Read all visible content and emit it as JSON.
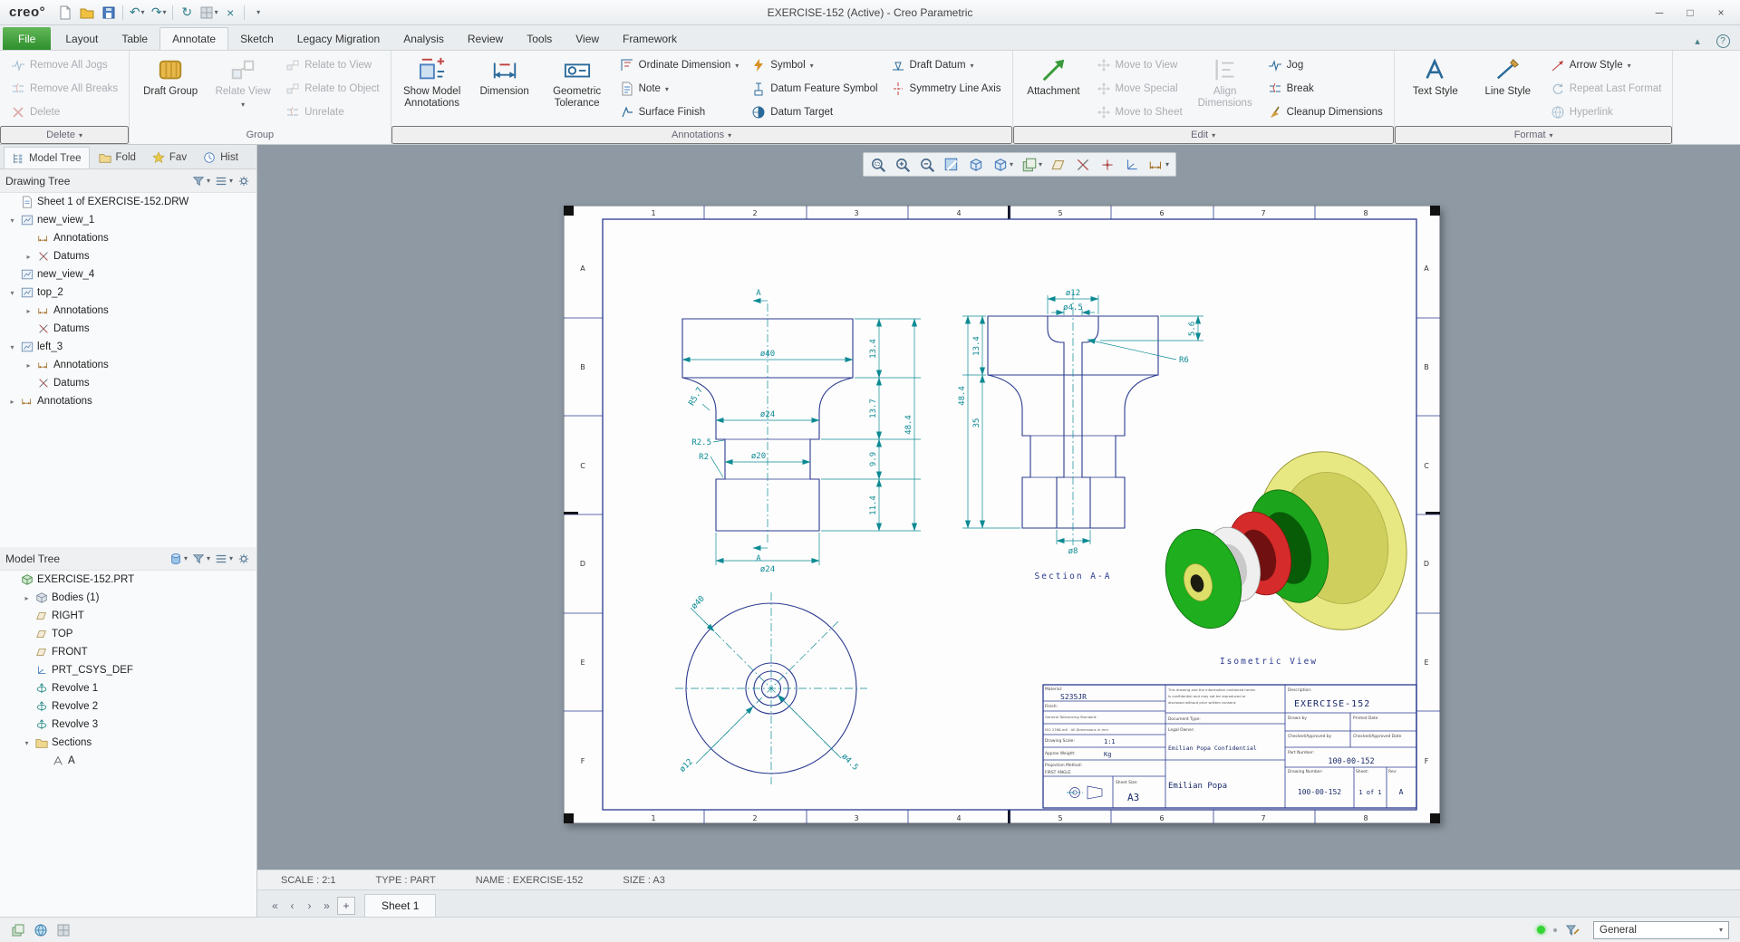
{
  "window": {
    "brand": "creo°",
    "title": "EXERCISE-152 (Active) - Creo Parametric"
  },
  "icons": {
    "dropdown": "▾",
    "open": "▾",
    "closed": "▸",
    "minimize": "─",
    "maximize": "□",
    "close": "×",
    "undo": "↶",
    "redo": "↷",
    "regen": "↻",
    "help": "?",
    "collapse": "▴",
    "first": "«",
    "prev": "‹",
    "next": "›",
    "last": "»",
    "plus": "+",
    "x": "×"
  },
  "tabs": [
    "File",
    "Layout",
    "Table",
    "Annotate",
    "Sketch",
    "Legacy Migration",
    "Analysis",
    "Review",
    "Tools",
    "View",
    "Framework"
  ],
  "ribbon": {
    "delete": {
      "label": "Delete",
      "i0": "Remove All Jogs",
      "i1": "Remove All Breaks",
      "i2": "Delete"
    },
    "group": {
      "label": "Group",
      "draft": "Draft Group",
      "relate_view": "Relate View",
      "i0": "Relate to View",
      "i1": "Relate to Object",
      "i2": "Unrelate"
    },
    "ann": {
      "label": "Annotations",
      "show": "Show Model Annotations",
      "dim": "Dimension",
      "gtol": "Geometric Tolerance",
      "i0": "Ordinate Dimension",
      "i1": "Note",
      "i2": "Surface Finish",
      "i3": "Symbol",
      "i4": "Datum Feature Symbol",
      "i5": "Datum Target",
      "i6": "Draft Datum",
      "i7": "Symmetry Line Axis"
    },
    "edit": {
      "label": "Edit",
      "attach": "Attachment",
      "i0": "Move to View",
      "i1": "Move Special",
      "i2": "Move to Sheet",
      "align": "Align Dimensions",
      "i3": "Jog",
      "i4": "Break",
      "i5": "Cleanup Dimensions"
    },
    "format": {
      "label": "Format",
      "text": "Text Style",
      "line": "Line Style",
      "i0": "Arrow Style",
      "i1": "Repeat Last Format",
      "i2": "Hyperlink"
    }
  },
  "panel_tabs": [
    "Model Tree",
    "Fold",
    "Fav",
    "Hist"
  ],
  "dtree": {
    "title": "Drawing Tree",
    "items": [
      {
        "label": "Sheet 1 of EXERCISE-152.DRW"
      },
      {
        "label": "new_view_1"
      },
      {
        "label": "Annotations"
      },
      {
        "label": "Datums"
      },
      {
        "label": "new_view_4"
      },
      {
        "label": "top_2"
      },
      {
        "label": "Annotations"
      },
      {
        "label": "Datums"
      },
      {
        "label": "left_3"
      },
      {
        "label": "Annotations"
      },
      {
        "label": "Datums"
      },
      {
        "label": "Annotations"
      }
    ]
  },
  "mtree": {
    "title": "Model Tree",
    "items": [
      {
        "label": "EXERCISE-152.PRT"
      },
      {
        "label": "Bodies (1)"
      },
      {
        "label": "RIGHT"
      },
      {
        "label": "TOP"
      },
      {
        "label": "FRONT"
      },
      {
        "label": "PRT_CSYS_DEF"
      },
      {
        "label": "Revolve 1"
      },
      {
        "label": "Revolve 2"
      },
      {
        "label": "Revolve 3"
      },
      {
        "label": "Sections"
      },
      {
        "label": "A"
      }
    ]
  },
  "status": {
    "scale": "SCALE : 2:1",
    "type": "TYPE : PART",
    "name": "NAME : EXERCISE-152",
    "size": "SIZE : A3"
  },
  "sheet_tab": "Sheet 1",
  "filter": {
    "value": "General"
  },
  "sheet": {
    "zones_c": [
      "1",
      "2",
      "3",
      "4",
      "5",
      "6",
      "7",
      "8"
    ],
    "zones_r": [
      "A",
      "B",
      "C",
      "D",
      "E",
      "F"
    ],
    "front": {
      "d40": "ø40",
      "d24": "ø24",
      "d20": "ø20",
      "d24b": "ø24",
      "h1": "13.4",
      "h2": "13.7",
      "h3": "9.9",
      "h4": "11.4",
      "ht": "48.4",
      "r1": "R2.5",
      "r2": "R2",
      "r3": "R5.7",
      "a": "A"
    },
    "sec": {
      "d12": "ø12",
      "d45": "ø4.5",
      "h1": "13.4",
      "ht": "48.4",
      "h2": "35",
      "dep": "5.6",
      "r6": "R6",
      "d8": "ø8",
      "label": "Section A-A"
    },
    "bot": {
      "d40": "ø40",
      "d12": "ø12",
      "d45": "ø4.5"
    },
    "iso": "Isometric View",
    "tb": {
      "material_l": "Material:",
      "material": "S235JR",
      "finish_l": "Finish:",
      "tol1": "General Tolerancing Standard:",
      "tol2": "ISO 2768-mK · All Dimensions in mm",
      "scale_l": "Drawing Scale:",
      "scale": "1:1",
      "weight_l": "Approx Weight:",
      "weight": "Kg",
      "proj_l": "Projection Method:",
      "proj": "FIRST ANGLE",
      "size_l": "Sheet Size:",
      "size": "A3",
      "note1": "This drawing and the information contained herein",
      "note2": "is confidential and may not be reproduced or",
      "note3": "disclosed without prior written consent.",
      "doctype_l": "Document Type:",
      "owner_l": "Legal Owner:",
      "conf": "Emilian Popa Confidential",
      "owner": "Emilian Popa",
      "desc_l": "Description:",
      "desc": "EXERCISE-152",
      "drawn_l": "Drawn by",
      "printed_l": "Printed Date",
      "checked_l": "Checked/Approved by",
      "checkdate_l": "Checked/Approved Date",
      "part_l": "Part Number:",
      "part": "100-00-152",
      "dwg_l": "Drawing Number:",
      "dwg": "100-00-152",
      "sheet_l": "Sheet:",
      "sheet": "1 of 1",
      "rev_l": "Rev:",
      "rev": "A"
    }
  }
}
